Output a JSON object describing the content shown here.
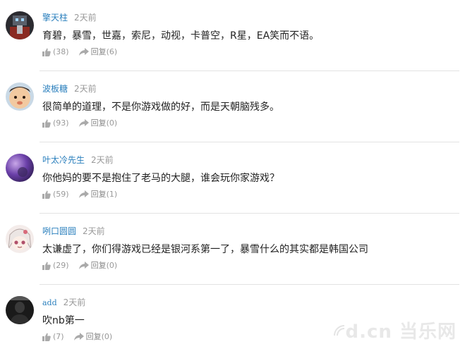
{
  "comments": [
    {
      "username": "擎天柱",
      "time": "2天前",
      "content": "育碧，暴雪，世嘉，索尼，动视，卡普空，R星，EA笑而不语。",
      "likes": "(38)",
      "reply_label": "回复",
      "replies": "(6)",
      "avatar": "transformer-avatar"
    },
    {
      "username": "波板糖",
      "time": "2天前",
      "content": "很简单的道理，不是你游戏做的好，而是天朝脑残多。",
      "likes": "(93)",
      "reply_label": "回复",
      "replies": "(0)",
      "avatar": "baby-avatar"
    },
    {
      "username": "叶太冷先生",
      "time": "2天前",
      "content": "你他妈的要不是抱住了老马的大腿，谁会玩你家游戏？",
      "likes": "(59)",
      "reply_label": "回复",
      "replies": "(1)",
      "avatar": "purple-avatar"
    },
    {
      "username": "咧口圆圆",
      "time": "2天前",
      "content": "太谦虚了，你们得游戏已经是银河系第一了，暴雪什么的其实都是韩国公司",
      "likes": "(29)",
      "reply_label": "回复",
      "replies": "(0)",
      "avatar": "anime-avatar"
    },
    {
      "username": "add",
      "time": "2天前",
      "content": "吹nb第一",
      "likes": "(7)",
      "reply_label": "回复",
      "replies": "(0)",
      "avatar": "dark-avatar"
    }
  ],
  "watermark": {
    "text": "d.cn 当乐网"
  },
  "colors": {
    "username": "#2a7fbd",
    "divider": "#e3e3e3",
    "muted": "#999999"
  }
}
